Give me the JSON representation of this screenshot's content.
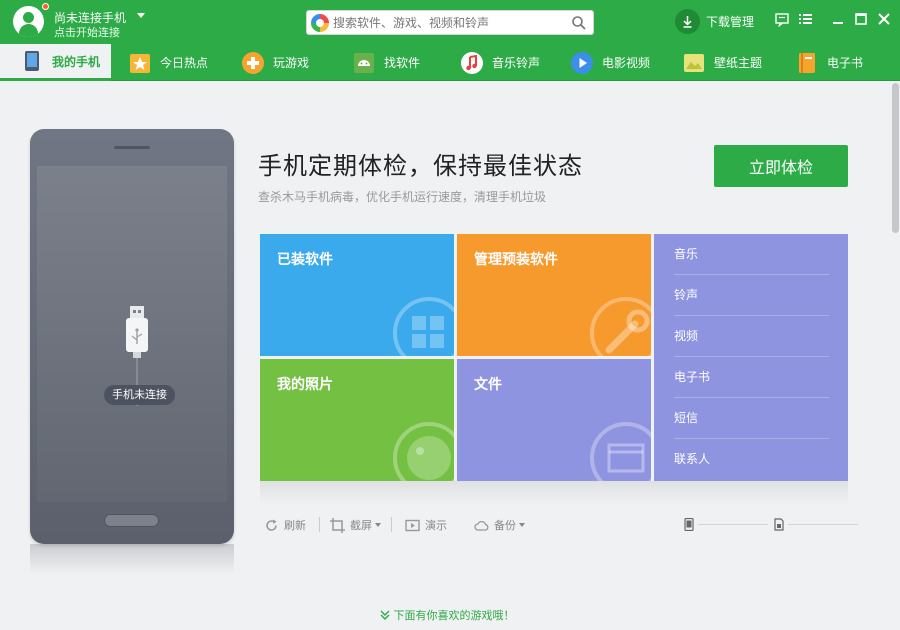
{
  "header": {
    "device_title": "尚未连接手机",
    "device_subtitle": "点击开始连接",
    "search_placeholder": "搜索软件、游戏、视频和铃声",
    "download_label": "下载管理"
  },
  "nav": {
    "items": [
      {
        "label": "我的手机",
        "icon": "phone-icon",
        "active": true
      },
      {
        "label": "今日热点",
        "icon": "star-icon"
      },
      {
        "label": "玩游戏",
        "icon": "gamepad-icon"
      },
      {
        "label": "找软件",
        "icon": "android-icon"
      },
      {
        "label": "音乐铃声",
        "icon": "music-icon"
      },
      {
        "label": "电影视频",
        "icon": "play-icon"
      },
      {
        "label": "壁纸主题",
        "icon": "wallpaper-icon"
      },
      {
        "label": "电子书",
        "icon": "book-icon"
      }
    ]
  },
  "phone": {
    "status": "手机未连接"
  },
  "main": {
    "headline": "手机定期体检，保持最佳状态",
    "subline": "查杀木马手机病毒，优化手机运行速度，清理手机垃圾",
    "check_button": "立即体检",
    "tiles": {
      "installed_apps": "已装软件",
      "preinstalled": "管理预装软件",
      "photos": "我的照片",
      "files": "文件"
    },
    "media_list": [
      "音乐",
      "铃声",
      "视频",
      "电子书",
      "短信",
      "联系人"
    ]
  },
  "toolbar": {
    "refresh": "刷新",
    "screenshot": "截屏",
    "demo": "演示",
    "backup": "备份"
  },
  "footer": {
    "hint": "下面有你喜欢的游戏哦！"
  },
  "colors": {
    "brand_green": "#2cab46",
    "tile_blue": "#3aaaec",
    "tile_orange": "#f79a2e",
    "tile_green": "#74c042",
    "tile_purple": "#8e94e0"
  }
}
